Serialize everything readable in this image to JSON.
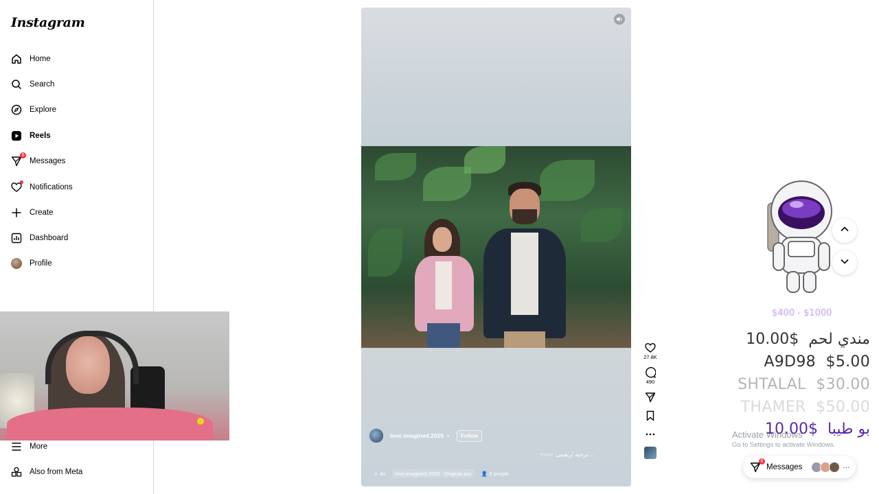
{
  "app": {
    "logo": "Instagram"
  },
  "sidebar": {
    "items": [
      {
        "label": "Home",
        "icon": "home-icon"
      },
      {
        "label": "Search",
        "icon": "search-icon"
      },
      {
        "label": "Explore",
        "icon": "compass-icon"
      },
      {
        "label": "Reels",
        "icon": "reels-icon",
        "active": true
      },
      {
        "label": "Messages",
        "icon": "messenger-icon",
        "badge": "6"
      },
      {
        "label": "Notifications",
        "icon": "heart-icon"
      },
      {
        "label": "Create",
        "icon": "plus-icon"
      },
      {
        "label": "Dashboard",
        "icon": "dashboard-icon"
      },
      {
        "label": "Profile",
        "icon": "avatar"
      }
    ],
    "bottom": [
      {
        "label": "More",
        "icon": "menu-icon"
      },
      {
        "label": "Also from Meta",
        "icon": "meta-icon"
      }
    ]
  },
  "reel": {
    "username": "love.imagined.2025",
    "separator": "•",
    "follow_label": "Follow",
    "caption": "ترجيه اربعيني ...",
    "more_label": "more",
    "audio_prefix": "lio",
    "audio_label": "love.imagined.2025 · Original auc",
    "people_label": "2 people",
    "likes": "27.8K",
    "comments": "490"
  },
  "overlay": {
    "goal": "$400 - $1000",
    "donations": [
      {
        "name": "مندي لحم",
        "amount": "$10.00",
        "style": "normal"
      },
      {
        "name": "A9D98",
        "amount": "$5.00",
        "style": "normal"
      },
      {
        "name": "SHTALAL",
        "amount": "$30.00",
        "style": "faded"
      },
      {
        "name": "THAMER",
        "amount": "$50.00",
        "style": "very"
      },
      {
        "name": "بو طيبا",
        "amount": "$10.00",
        "style": "purple"
      }
    ]
  },
  "windows_notice": {
    "title": "Activate Windows",
    "subtitle": "Go to Settings to activate Windows."
  },
  "messages_pill": {
    "label": "Messages",
    "badge": "6",
    "more": "···"
  },
  "colors": {
    "accent_red": "#ff3040",
    "purple": "#5b2aa6",
    "border": "#dbdbdb"
  }
}
